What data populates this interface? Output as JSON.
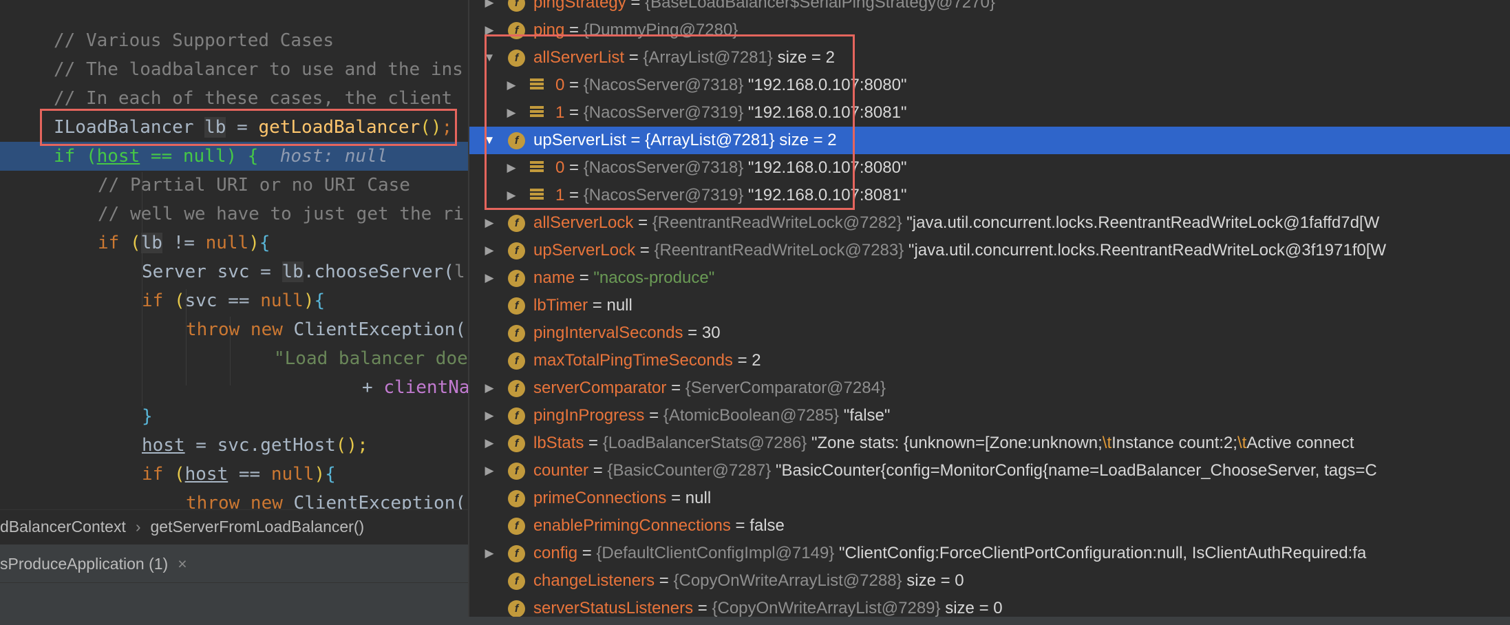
{
  "editor": {
    "lines": [
      {
        "tokens": [
          {
            "t": "// Various Supported Cases",
            "c": "cm"
          }
        ]
      },
      {
        "tokens": [
          {
            "t": "// The loadbalancer to use and the ins",
            "c": "cm"
          }
        ]
      },
      {
        "tokens": [
          {
            "t": "// In each of these cases, the client",
            "c": "cm"
          }
        ]
      },
      {
        "tokens": [
          {
            "t": "ILoadBalancer "
          },
          {
            "t": "lb",
            "c": "hl"
          },
          {
            "t": " = "
          },
          {
            "t": "getLoadBalancer",
            "c": "mth"
          },
          {
            "t": "()",
            "c": "ye"
          },
          {
            "t": ";",
            "c": "kw"
          }
        ]
      },
      {
        "tokens": [
          {
            "t": "if ",
            "c": "green"
          },
          {
            "t": "(",
            "c": "green"
          },
          {
            "t": "host",
            "c": "green ul"
          },
          {
            "t": " == ",
            "c": "green"
          },
          {
            "t": "null",
            "c": "green"
          },
          {
            "t": ") {  ",
            "c": "green"
          },
          {
            "t": "host: null",
            "c": "inl"
          }
        ],
        "exec": true
      },
      {
        "tokens": [
          {
            "t": "// Partial URI or no URI Case",
            "c": "cm"
          }
        ]
      },
      {
        "tokens": [
          {
            "t": "// well we have to just get the ri",
            "c": "cm"
          }
        ]
      },
      {
        "tokens": [
          {
            "t": "if ",
            "c": "kw"
          },
          {
            "t": "(",
            "c": "ye"
          },
          {
            "t": "lb",
            "c": "hl"
          },
          {
            "t": " != "
          },
          {
            "t": "null",
            "c": "kw"
          },
          {
            "t": ")",
            "c": "ye"
          },
          {
            "t": "{",
            "c": "bl"
          }
        ]
      },
      {
        "tokens": [
          {
            "t": "Server svc = "
          },
          {
            "t": "lb",
            "c": "hl"
          },
          {
            "t": ".chooseServer("
          },
          {
            "t": "l",
            "c": "cm"
          }
        ]
      },
      {
        "tokens": [
          {
            "t": "if ",
            "c": "kw"
          },
          {
            "t": "(",
            "c": "ye"
          },
          {
            "t": "svc == "
          },
          {
            "t": "null",
            "c": "kw"
          },
          {
            "t": ")",
            "c": "ye"
          },
          {
            "t": "{",
            "c": "bl"
          }
        ]
      },
      {
        "tokens": [
          {
            "t": "throw new ",
            "c": "kw"
          },
          {
            "t": "ClientException("
          }
        ]
      },
      {
        "tokens": [
          {
            "t": "\"Load balancer doe",
            "c": "str"
          }
        ]
      },
      {
        "tokens": [
          {
            "t": "+ "
          },
          {
            "t": "clientNa",
            "c": "pu"
          }
        ]
      },
      {
        "tokens": [
          {
            "t": "}",
            "c": "bl"
          }
        ]
      },
      {
        "tokens": [
          {
            "t": "host",
            "c": "ul"
          },
          {
            "t": " = svc.getHost"
          },
          {
            "t": "();",
            "c": "ye"
          }
        ]
      },
      {
        "tokens": [
          {
            "t": "if ",
            "c": "kw"
          },
          {
            "t": "(",
            "c": "ye"
          },
          {
            "t": "host",
            "c": "ul"
          },
          {
            "t": " == "
          },
          {
            "t": "null",
            "c": "kw"
          },
          {
            "t": ")",
            "c": "ye"
          },
          {
            "t": "{",
            "c": "bl"
          }
        ]
      },
      {
        "tokens": [
          {
            "t": "throw new ",
            "c": "kw"
          },
          {
            "t": "ClientException("
          }
        ]
      }
    ]
  },
  "breadcrumb": {
    "items": [
      "dBalancerContext",
      "getServerFromLoadBalancer()"
    ],
    "separator": "›"
  },
  "run_tab": {
    "label": "sProduceApplication (1)",
    "close": "×"
  },
  "variables": [
    {
      "arrow": "▶",
      "icon": "f",
      "name": "pingStrategy",
      "ref": "{BaseLoadBalancer$SerialPingStrategy@7270}",
      "extra": ""
    },
    {
      "arrow": "▶",
      "icon": "f",
      "name": "ping",
      "ref": "{DummyPing@7280}",
      "extra": ""
    },
    {
      "arrow": "▼",
      "icon": "f",
      "name": "allServerList",
      "ref": "{ArrayList@7281}",
      "extra": " size = 2"
    },
    {
      "arrow": "▶",
      "icon": "a",
      "name": "0",
      "ref": "{NacosServer@7318}",
      "extra": "\"192.168.0.107:8080\"",
      "indent": true
    },
    {
      "arrow": "▶",
      "icon": "a",
      "name": "1",
      "ref": "{NacosServer@7319}",
      "extra": "\"192.168.0.107:8081\"",
      "indent": true
    },
    {
      "arrow": "▼",
      "icon": "f",
      "name": "upServerList",
      "ref": "{ArrayList@7281}",
      "extra": " size = 2",
      "selected": true
    },
    {
      "arrow": "▶",
      "icon": "a",
      "name": "0",
      "ref": "{NacosServer@7318}",
      "extra": "\"192.168.0.107:8080\"",
      "indent": true
    },
    {
      "arrow": "▶",
      "icon": "a",
      "name": "1",
      "ref": "{NacosServer@7319}",
      "extra": "\"192.168.0.107:8081\"",
      "indent": true
    },
    {
      "arrow": "▶",
      "icon": "f",
      "name": "allServerLock",
      "ref": "{ReentrantReadWriteLock@7282}",
      "extra": "\"java.util.concurrent.locks.ReentrantReadWriteLock@1faffd7d[W"
    },
    {
      "arrow": "▶",
      "icon": "f",
      "name": "upServerLock",
      "ref": "{ReentrantReadWriteLock@7283}",
      "extra": "\"java.util.concurrent.locks.ReentrantReadWriteLock@3f1971f0[W"
    },
    {
      "arrow": "▶",
      "icon": "f",
      "name": "name",
      "ref": "",
      "extra": "",
      "green": "\"nacos-produce\""
    },
    {
      "arrow": "",
      "icon": "f",
      "name": "lbTimer",
      "ref": "",
      "extra": "",
      "plain": "null"
    },
    {
      "arrow": "",
      "icon": "f",
      "name": "pingIntervalSeconds",
      "ref": "",
      "extra": "",
      "plain": "30"
    },
    {
      "arrow": "",
      "icon": "f",
      "name": "maxTotalPingTimeSeconds",
      "ref": "",
      "extra": "",
      "plain": "2"
    },
    {
      "arrow": "▶",
      "icon": "f",
      "name": "serverComparator",
      "ref": "{ServerComparator@7284}",
      "extra": ""
    },
    {
      "arrow": "▶",
      "icon": "f",
      "name": "pingInProgress",
      "ref": "{AtomicBoolean@7285}",
      "extra": "\"false\""
    },
    {
      "arrow": "▶",
      "icon": "f",
      "name": "lbStats",
      "ref": "{LoadBalancerStats@7286}",
      "extra": "",
      "stats": [
        "\"Zone stats: {unknown=[Zone:unknown;",
        "\\t",
        "Instance count:2;",
        "\\t",
        "Active connect"
      ]
    },
    {
      "arrow": "▶",
      "icon": "f",
      "name": "counter",
      "ref": "{BasicCounter@7287}",
      "extra": "\"BasicCounter{config=MonitorConfig{name=LoadBalancer_ChooseServer, tags=C"
    },
    {
      "arrow": "",
      "icon": "f",
      "name": "primeConnections",
      "ref": "",
      "extra": "",
      "plain": "null"
    },
    {
      "arrow": "",
      "icon": "f",
      "name": "enablePrimingConnections",
      "ref": "",
      "extra": "",
      "plain": "false"
    },
    {
      "arrow": "▶",
      "icon": "f",
      "name": "config",
      "ref": "{DefaultClientConfigImpl@7149}",
      "extra": "\"ClientConfig:ForceClientPortConfiguration:null, IsClientAuthRequired:fa"
    },
    {
      "arrow": "",
      "icon": "f",
      "name": "changeListeners",
      "ref": "{CopyOnWriteArrayList@7288}",
      "extra": " size = 0"
    },
    {
      "arrow": "",
      "icon": "f",
      "name": "serverStatusListeners",
      "ref": "{CopyOnWriteArrayList@7289}",
      "extra": " size = 0"
    }
  ],
  "colors": {
    "highlight_box": "#e5655d",
    "selection": "#2f65ca",
    "exec_line": "#2d4f7c"
  }
}
